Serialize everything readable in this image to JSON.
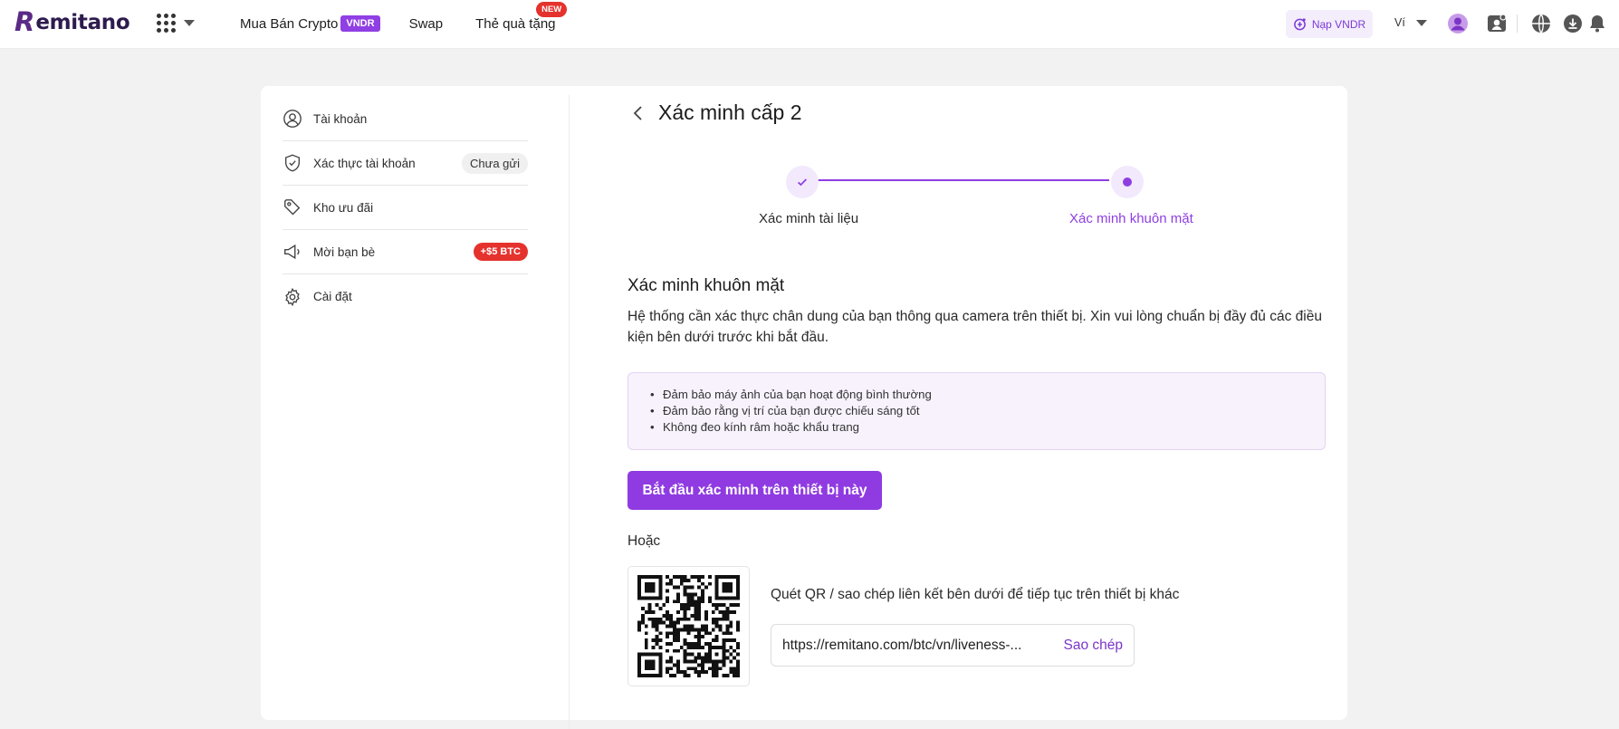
{
  "brand": {
    "logo_mark": "R",
    "logo_text": "emitano",
    "accent": "#8f3be1",
    "logo_color": "#5b2a86"
  },
  "nav": {
    "buy_crypto": "Mua Bán Crypto",
    "buy_crypto_badge": "VNDR",
    "swap": "Swap",
    "gift_cards": "Thẻ quà tặng",
    "gift_badge": "NEW"
  },
  "topright": {
    "deposit_label": "Nạp VNDR",
    "wallet_label": "Ví",
    "icons": [
      "avatar-icon",
      "support-icon",
      "globe-icon",
      "download-icon",
      "bell-icon"
    ]
  },
  "sidebar": {
    "items": [
      {
        "label": "Tài khoản",
        "icon": "user-icon"
      },
      {
        "label": "Xác thực tài khoản",
        "icon": "shield-icon",
        "badge": "Chưa gửi"
      },
      {
        "label": "Kho ưu đãi",
        "icon": "tag-icon"
      },
      {
        "label": "Mời bạn bè",
        "icon": "megaphone-icon",
        "badge": "+$5 BTC"
      },
      {
        "label": "Cài đặt",
        "icon": "gear-icon"
      }
    ]
  },
  "main": {
    "title": "Xác minh cấp 2",
    "steps": [
      {
        "label": "Xác minh tài liệu",
        "status": "done"
      },
      {
        "label": "Xác minh khuôn mặt",
        "status": "active"
      }
    ],
    "section_title": "Xác minh khuôn mặt",
    "section_desc": "Hệ thống cần xác thực chân dung của bạn thông qua camera trên thiết bị. Xin vui lòng chuẩn bị đầy đủ các điều kiện bên dưới trước khi bắt đầu.",
    "requirements": [
      "Đảm bảo máy ảnh của bạn hoạt động bình thường",
      "Đảm bảo rằng vị trí của bạn được chiếu sáng tốt",
      "Không đeo kính râm hoặc khẩu trang"
    ],
    "start_button": "Bắt đầu xác minh trên thiết bị này",
    "or_text": "Hoặc",
    "qr_hint": "Quét QR / sao chép liên kết bên dưới để tiếp tục trên thiết bị khác",
    "link_value": "https://remitano.com/btc/vn/liveness-...",
    "copy_button": "Sao chép"
  }
}
